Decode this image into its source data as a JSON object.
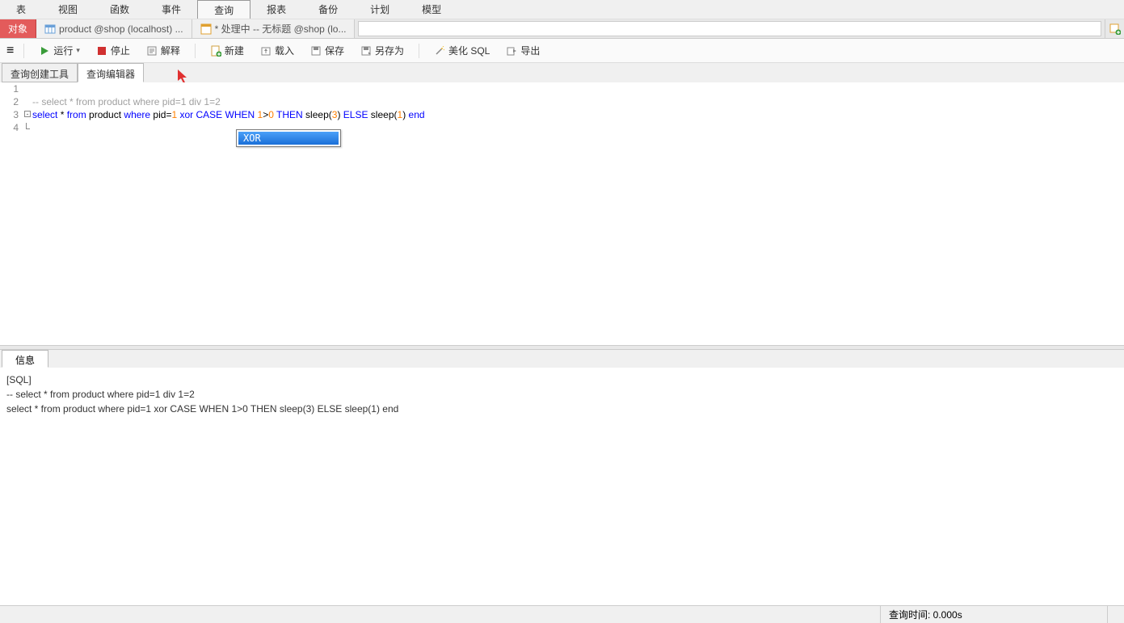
{
  "menu": {
    "items": [
      "表",
      "视图",
      "函数",
      "事件",
      "查询",
      "报表",
      "备份",
      "计划",
      "模型"
    ],
    "active_index": 4
  },
  "top_tabs": {
    "object": "对象",
    "tab1": "product @shop (localhost) ...",
    "tab2": "* 处理中 -- 无标题 @shop (lo..."
  },
  "toolbar": {
    "run": "运行",
    "stop": "停止",
    "explain": "解释",
    "new": "新建",
    "load": "载入",
    "save": "保存",
    "save_as": "另存为",
    "beautify": "美化 SQL",
    "export": "导出"
  },
  "inner_tabs": {
    "builder": "查询创建工具",
    "editor": "查询编辑器"
  },
  "code": {
    "line1": "",
    "line2_comment": "-- select * from product where pid=1 div 1=2",
    "line3_kw_select": "select",
    "line3_star": " * ",
    "line3_kw_from": "from",
    "line3_product": " product ",
    "line3_kw_where": "where",
    "line3_pid": " pid=",
    "line3_num1": "1",
    "line3_xor": " xor ",
    "line3_kw_case": "CASE",
    "line3_sp1": " ",
    "line3_kw_when": "WHEN",
    "line3_sp2": " ",
    "line3_num1b": "1",
    "line3_gt": ">",
    "line3_num0": "0",
    "line3_sp3": " ",
    "line3_kw_then": "THEN",
    "line3_sleep3": " sleep(",
    "line3_num3": "3",
    "line3_paren1": ") ",
    "line3_kw_else": "ELSE",
    "line3_sleep1": " sleep(",
    "line3_num1c": "1",
    "line3_paren2": ") ",
    "line3_kw_end": "end",
    "line_nums": [
      "1",
      "2",
      "3",
      "4"
    ]
  },
  "autocomplete": {
    "item": "XOR"
  },
  "info_tab": "信息",
  "info_panel": {
    "line1": "[SQL]",
    "line2": "-- select * from product where pid=1 div 1=2",
    "line3": "select * from product where pid=1 xor CASE WHEN 1>0 THEN sleep(3) ELSE sleep(1) end"
  },
  "status": {
    "query_time": "查询时间: 0.000s"
  }
}
